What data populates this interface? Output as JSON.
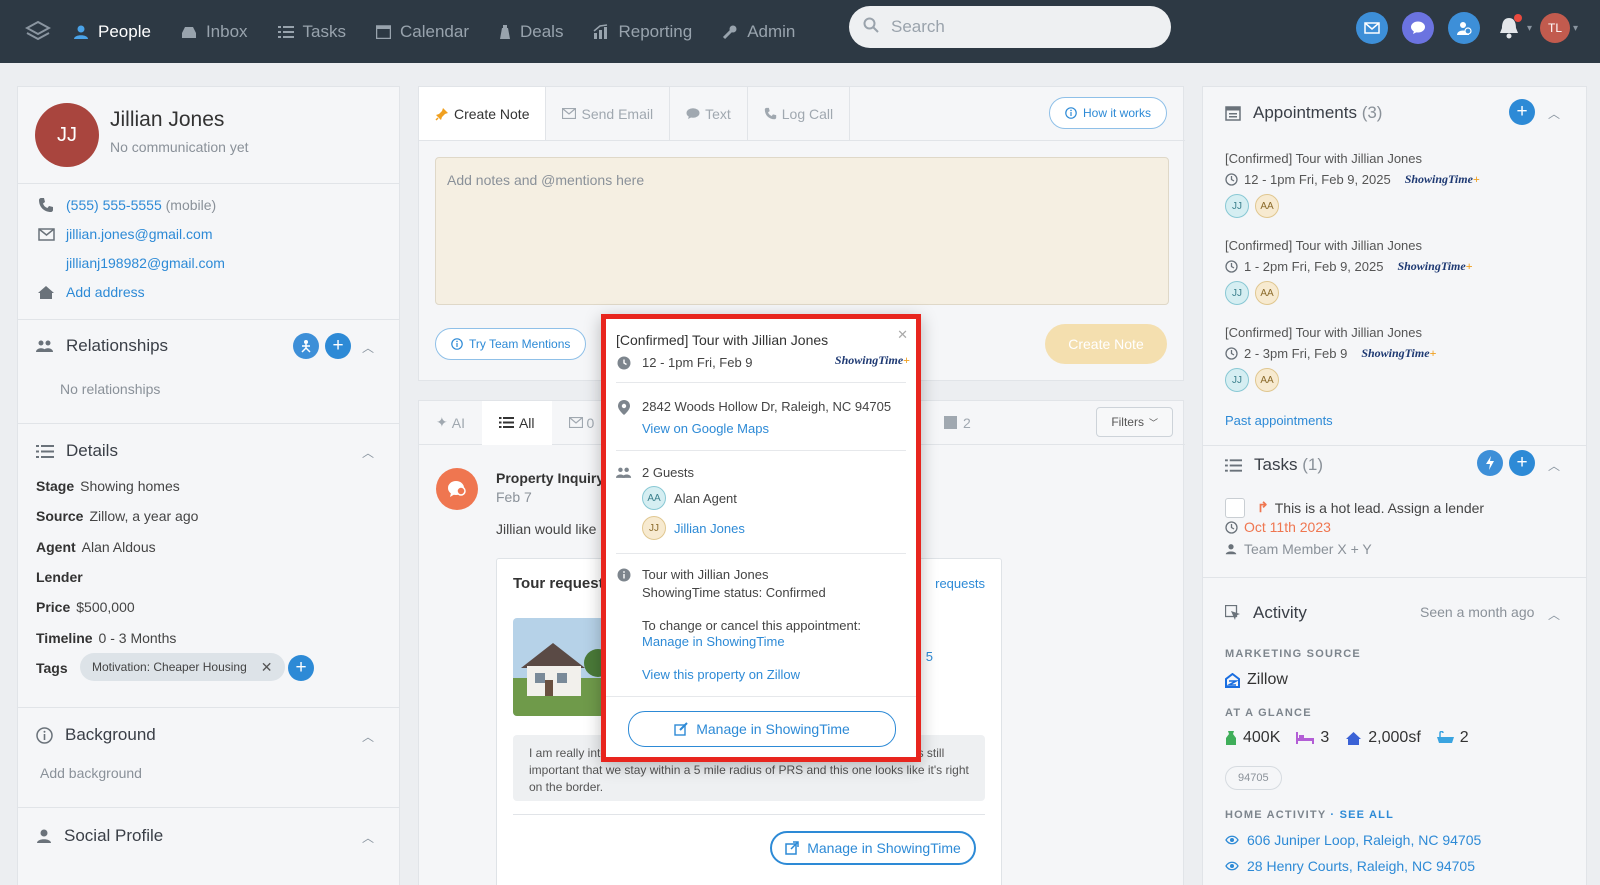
{
  "nav": {
    "items": [
      {
        "label": "People",
        "icon": "person-icon"
      },
      {
        "label": "Inbox",
        "icon": "inbox-icon"
      },
      {
        "label": "Tasks",
        "icon": "tasks-icon"
      },
      {
        "label": "Calendar",
        "icon": "calendar-icon"
      },
      {
        "label": "Deals",
        "icon": "deals-icon"
      },
      {
        "label": "Reporting",
        "icon": "reporting-icon"
      },
      {
        "label": "Admin",
        "icon": "wrench-icon"
      }
    ],
    "search_placeholder": "Search",
    "user_initials": "TL"
  },
  "contact": {
    "initials": "JJ",
    "name": "Jillian Jones",
    "status": "No communication yet",
    "phone": "(555) 555-5555",
    "phone_type": "(mobile)",
    "email1": "jillian.jones@gmail.com",
    "email2": "jillianj198982@gmail.com",
    "add_address": "Add address"
  },
  "relationships": {
    "title": "Relationships",
    "empty": "No relationships"
  },
  "details": {
    "title": "Details",
    "fields": [
      {
        "label": "Stage",
        "value": "Showing homes"
      },
      {
        "label": "Source",
        "value": "Zillow, a year ago"
      },
      {
        "label": "Agent",
        "value": "Alan Aldous"
      },
      {
        "label": "Lender",
        "value": ""
      },
      {
        "label": "Price",
        "value": "$500,000"
      },
      {
        "label": "Timeline",
        "value": "0 - 3 Months"
      }
    ],
    "tags_label": "Tags",
    "tag": "Motivation: Cheaper Housing"
  },
  "background": {
    "title": "Background",
    "placeholder": "Add background"
  },
  "social": {
    "title": "Social Profile"
  },
  "compose": {
    "tabs": [
      "Create Note",
      "Send Email",
      "Text",
      "Log Call"
    ],
    "how_it_works": "How it works",
    "note_placeholder": "Add notes and @mentions here",
    "team_mentions": "Try Team Mentions",
    "create_note": "Create Note"
  },
  "feed": {
    "ai_tab": "AI",
    "all_tab": "All",
    "email_count": "0",
    "other_count": "2",
    "filters": "Filters",
    "item_title": "Property Inquiry",
    "item_date": "Feb 7",
    "item_text": "Jillian would like",
    "card_title": "Tour request",
    "card_link": "requests",
    "card_fragment": "5",
    "message": "I am really interested in this property, how close to PRS district it is in? It is still important that we stay within a 5 mile radius of PRS and this one looks like it's right on the border.",
    "manage_btn": "Manage in ShowingTime"
  },
  "popup": {
    "title": "[Confirmed] Tour with Jillian Jones",
    "time": "12 - 1pm Fri, Feb 9",
    "address": "2842 Woods Hollow Dr, Raleigh, NC 94705",
    "maps_link": "View on Google Maps",
    "guests_label": "2 Guests",
    "guest1_initials": "AA",
    "guest1": "Alan Agent",
    "guest2_initials": "JJ",
    "guest2": "Jillian Jones",
    "info_line1": "Tour with Jillian Jones",
    "info_line2": "ShowingTime status: Confirmed",
    "change_text": "To change or cancel this appointment:",
    "manage_link": "Manage in ShowingTime",
    "zillow_link": "View this property on Zillow",
    "manage_btn": "Manage in ShowingTime",
    "brand": "ShowingTime"
  },
  "appointments": {
    "title": "Appointments",
    "count": "(3)",
    "items": [
      {
        "title": "[Confirmed] Tour with Jillian Jones",
        "time": "12 - 1pm Fri, Feb 9, 2025"
      },
      {
        "title": "[Confirmed] Tour with Jillian Jones",
        "time": "1 - 2pm Fri, Feb 9, 2025"
      },
      {
        "title": "[Confirmed] Tour with Jillian Jones",
        "time": "2 - 3pm Fri, Feb 9"
      }
    ],
    "chip1": "JJ",
    "chip2": "AA",
    "brand": "ShowingTime",
    "past": "Past appointments"
  },
  "tasks": {
    "title": "Tasks",
    "count": "(1)",
    "task": "This is a hot lead. Assign a lender",
    "due": "Oct 11th 2023",
    "assignee": "Team Member X + Y"
  },
  "activity": {
    "title": "Activity",
    "seen": "Seen a month ago",
    "marketing_label": "MARKETING SOURCE",
    "marketing_value": "Zillow",
    "glance_label": "AT A GLANCE",
    "price": "400K",
    "beds": "3",
    "sqft": "2,000sf",
    "baths": "2",
    "zip": "94705",
    "home_label": "HOME ACTIVITY",
    "see_all": "SEE ALL",
    "home1": "606 Juniper Loop, Raleigh, NC 94705",
    "home2": "28 Henry Courts, Raleigh, NC 94705"
  },
  "colors": {
    "accent": "#2d8ad6",
    "nav_bg": "#2d3944",
    "highlight": "#e8251e",
    "avatar": "#a9453e"
  }
}
